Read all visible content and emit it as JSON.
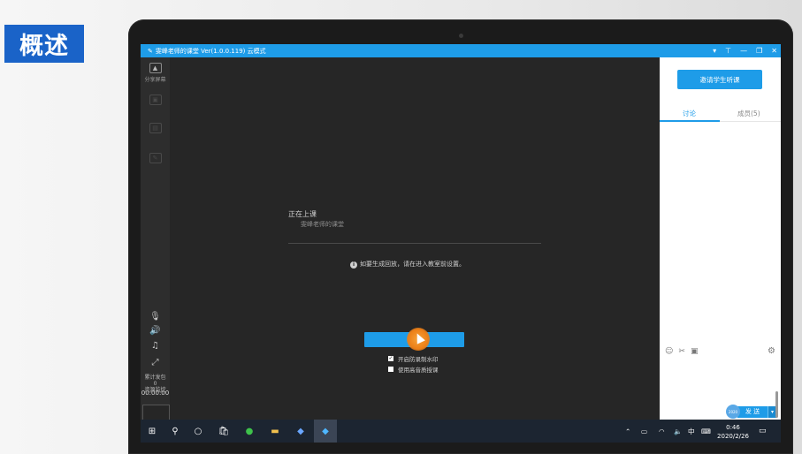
{
  "section_tag": "概述",
  "window": {
    "title": "雯峰老师的课堂 Ver(1.0.0.119)  云模式",
    "controls": [
      "▾",
      "⊤",
      "—",
      "❐",
      "✕"
    ]
  },
  "rail": {
    "share_screen_label": "分享屏幕",
    "dim_items": [
      "",
      "",
      ""
    ],
    "timer": "00:00:00",
    "cumulative_label": "累计发包",
    "cumulative_value": "0",
    "monitor_label": "资源监控"
  },
  "stage": {
    "status_title": "正在上课",
    "status_sub": "雯峰老师的课堂",
    "tip": "如要生成回放，请在进入教室前设置。",
    "start_button": "上",
    "options": [
      {
        "label": "开启防录制水印",
        "checked": true
      },
      {
        "label": "使用高音质授课",
        "checked": false
      }
    ]
  },
  "panel": {
    "invite_button": "邀请学生听课",
    "tabs": [
      {
        "label": "讨论",
        "active": true
      },
      {
        "label": "成员(5)",
        "active": false
      }
    ],
    "send_button": "发 送",
    "badge_text": "2020"
  },
  "taskbar": {
    "tray_ime": "中",
    "time": "0:46",
    "date": "2020/2/26"
  },
  "colors": {
    "accent": "#1e9ce8",
    "section_tag": "#1a63c8",
    "taskbar": "#1c2531",
    "stage": "#262626"
  }
}
